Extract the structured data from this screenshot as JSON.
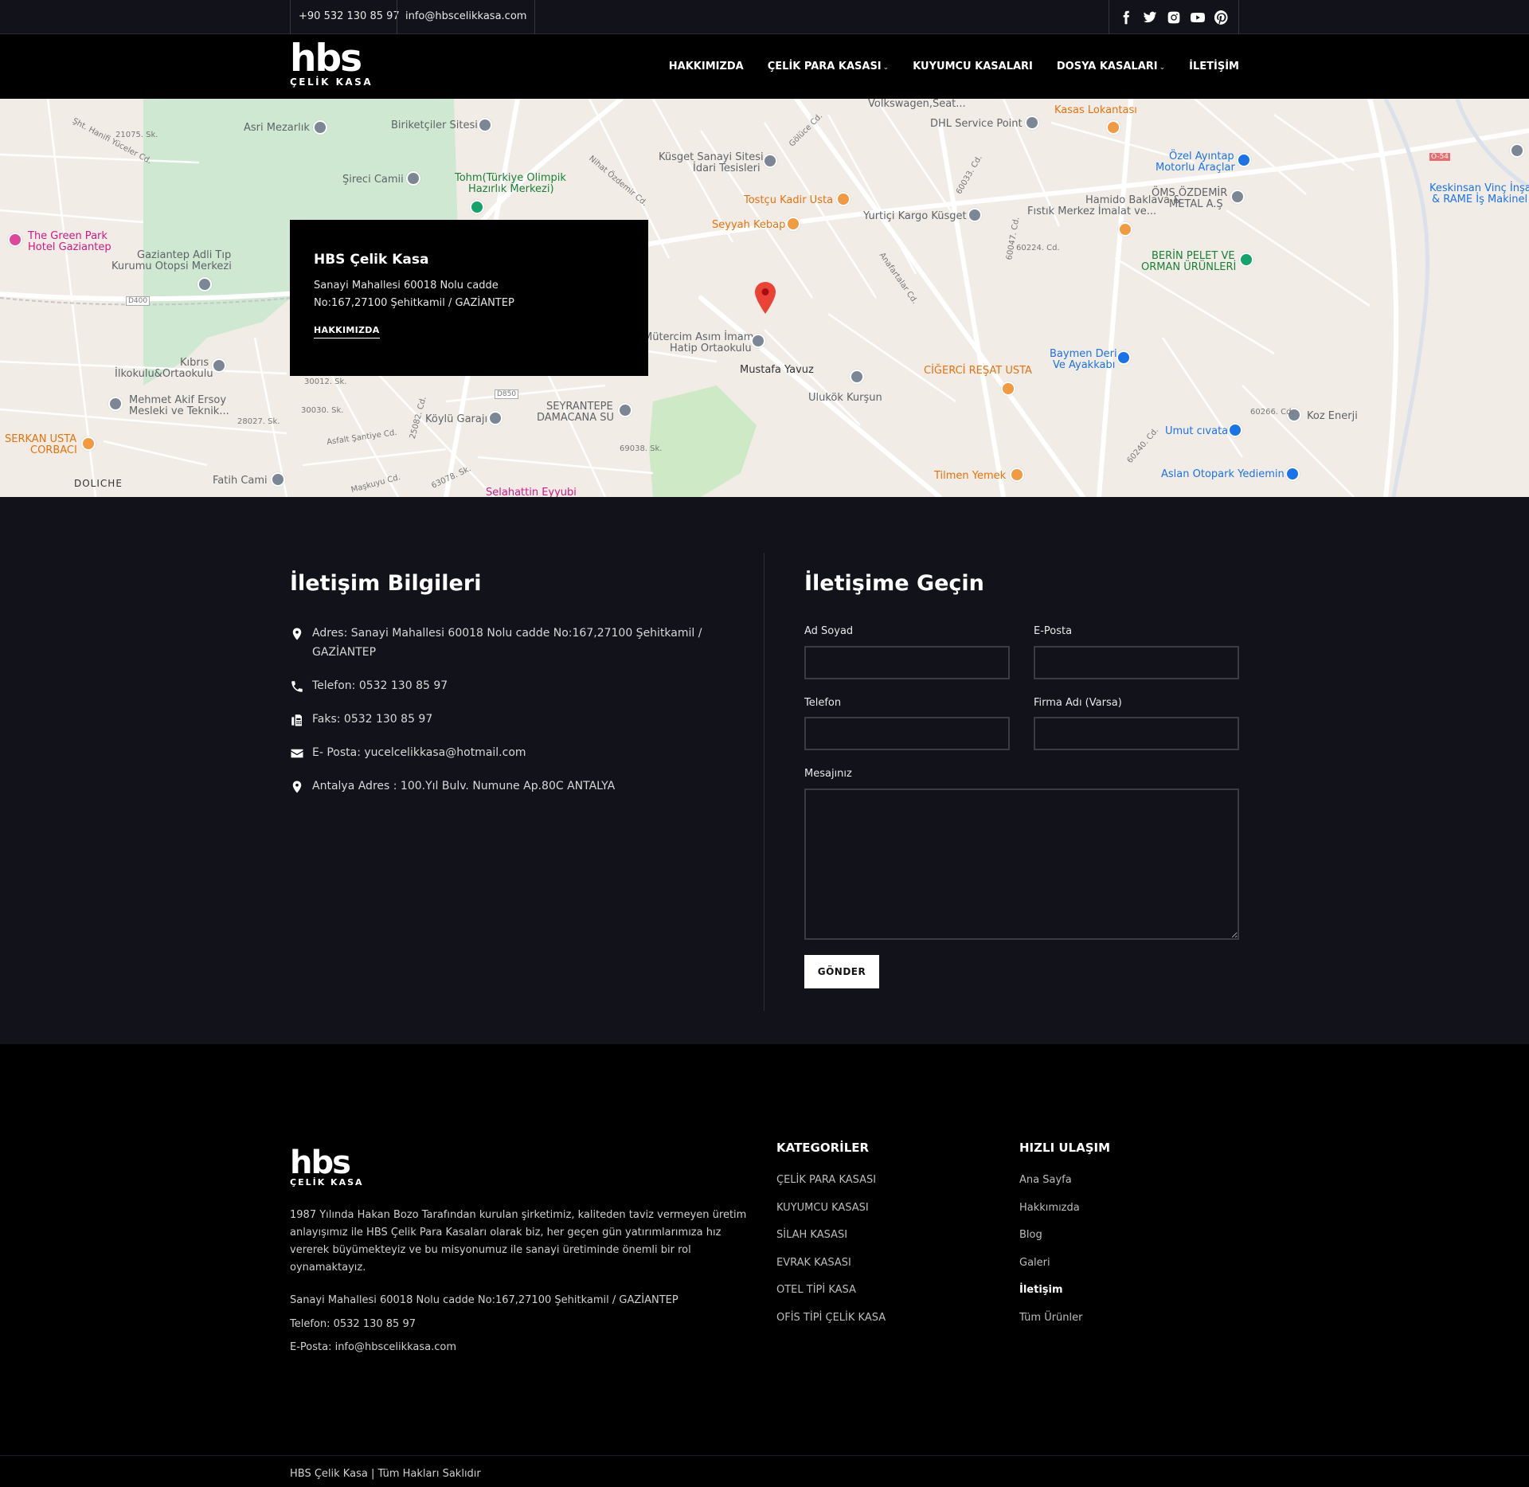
{
  "topbar": {
    "phone": "+90 532 130 85 97",
    "email": "info@hbscelikkasa.com",
    "social": [
      "facebook-icon",
      "twitter-icon",
      "instagram-icon",
      "youtube-icon",
      "pinterest-icon"
    ]
  },
  "header": {
    "logo_main": "hbs",
    "logo_sub": "ÇELİK KASA",
    "nav": [
      {
        "label": "HAKKIMIZDA",
        "dropdown": false
      },
      {
        "label": "ÇELİK PARA KASASI",
        "dropdown": true
      },
      {
        "label": "KUYUMCU KASALARI",
        "dropdown": false
      },
      {
        "label": "DOSYA KASALARI",
        "dropdown": true
      },
      {
        "label": "İLETİŞİM",
        "dropdown": false
      }
    ]
  },
  "map": {
    "card_title": "HBS Çelik Kasa",
    "card_address_1": "Sanayi Mahallesi 60018 Nolu cadde",
    "card_address_2": "No:167,27100 Şehitkamil / GAZİANTEP",
    "card_link": "HAKKIMIZDA",
    "places": {
      "asri": "Asri Mezarlık",
      "biriket": "Biriketçiler Sitesi",
      "sirec": "Şireci Camii",
      "tohm1": "Tohm(Türkiye Olimpik",
      "tohm2": "Hazırlık Merkezi)",
      "kusget1": "Küsget Sanayi Sitesi",
      "kusget2": "İdari Tesisleri",
      "tostcu": "Tostçu Kadir Usta",
      "seyyah": "Seyyah Kebap",
      "dhl": "DHL Service Point",
      "volks": "Volkswagen,Seat...",
      "kasas": "Kasas Lokantası",
      "ozel1": "Özel Ayıntap",
      "ozel2": "Motorlu Araçlar",
      "oms1": "ÖMS ÖZDEMİR",
      "oms2": "METAL A.Ş",
      "hamido1": "Hamido Baklava &",
      "hamido2": "Fıstık Merkez İmalat ve...",
      "yurtici": "Yurtiçi Kargo Küsget",
      "keskin1": "Keskinsan Vinç İnşa",
      "keskin2": "& RAME İş Makinel",
      "berin1": "BERİN PELET VE",
      "berin2": "ORMAN ÜRÜNLERİ",
      "green1": "The Green Park",
      "green2": "Hotel Gaziantep",
      "adli1": "Gaziantep Adli Tıp",
      "adli2": "Kurumu Otopsi Merkezi",
      "kibris1": "Kıbrıs",
      "kibris2": "İlkokulu&Ortaokulu",
      "mehmet1": "Mehmet Akif Ersoy",
      "mehmet2": "Mesleki ve Teknik...",
      "serkan1": "SERKAN USTA",
      "serkan2": "CORBACI",
      "doliche": "DOLICHE",
      "fatih": "Fatih Cami",
      "koylu": "Köylü Garajı",
      "seyrantepe1": "SEYRANTEPE",
      "seyrantepe2": "DAMACANA SU",
      "asim1": "Mütercim Asım İmam",
      "asim2": "Hatip Ortaokulu",
      "mustafa": "Mustafa Yavuz",
      "ulukok": "Ulukök Kurşun",
      "cigerci": "CİĞERCİ REŞAT USTA",
      "baymen1": "Baymen Deri",
      "baymen2": "Ve Ayakkabı",
      "koz": "Koz Enerji",
      "umut": "Umut cıvata",
      "tilmen": "Tilmen Yemek",
      "aslan": "Aslan Otopark Yediemin",
      "selahattin": "Selahattin Eyyubi"
    },
    "roads": {
      "r1": "Şht. Hanifi Yüceler Cd.",
      "r2": "21075. Sk.",
      "r3": "Nihat Özdemir Cd.",
      "r4": "Gölüce Cd.",
      "r5": "Anafartalar Cd.",
      "r6": "60033. Cd.",
      "r7": "60047. Cd.",
      "r8": "60224. Cd.",
      "r9": "25082. Cd.",
      "r10": "Maşkuyu Cd.",
      "r11": "63078. Sk.",
      "r12": "69038. Sk.",
      "r13": "30012. Sk.",
      "r14": "30030. Sk.",
      "r15": "28027. Sk.",
      "r16": "60266. Cd.",
      "r17": "60240. Cd.",
      "r18": "D400",
      "r19": "D850",
      "r20": "O-54",
      "r21": "Asfalt Şantiye Cd."
    }
  },
  "contact": {
    "info_title": "İletişim Bilgileri",
    "info": [
      {
        "icon": "map-marker-icon",
        "text": "Adres: Sanayi Mahallesi 60018 Nolu cadde No:167,27100 Şehitkamil / GAZİANTEP"
      },
      {
        "icon": "phone-icon",
        "text": "Telefon: 0532 130 85 97"
      },
      {
        "icon": "fax-icon",
        "text": "Faks: 0532 130 85 97"
      },
      {
        "icon": "envelope-icon",
        "text": "E- Posta: yucelcelikkasa@hotmail.com"
      },
      {
        "icon": "map-marker-icon",
        "text": "Antalya Adres : 100.Yıl Bulv. Numune Ap.80C ANTALYA"
      }
    ],
    "form_title": "İletişime Geçin",
    "labels": {
      "name": "Ad Soyad",
      "email": "E-Posta",
      "phone": "Telefon",
      "company": "Firma Adı (Varsa)",
      "message": "Mesajınız"
    },
    "values": {
      "name": "",
      "email": "",
      "phone": "",
      "company": "",
      "message": ""
    },
    "submit": "GÖNDER"
  },
  "footer": {
    "logo_main": "hbs",
    "logo_sub": "ÇELİK KASA",
    "about": "1987 Yılında Hakan Bozo Tarafından kurulan şirketimiz, kaliteden taviz vermeyen üretim anlayışımız ile HBS Çelik Para Kasaları olarak biz, her geçen gün yatırımlarımıza hız vererek büyümekteyiz ve bu misyonumuz ile sanayi üretiminde önemli bir rol oynamaktayız.",
    "address": "Sanayi Mahallesi 60018 Nolu cadde No:167,27100 Şehitkamil / GAZİANTEP",
    "phone": "Telefon: 0532 130 85 97",
    "email": "E-Posta: info@hbscelikkasa.com",
    "categories_title": "KATEGORİLER",
    "categories": [
      "ÇELİK PARA KASASI",
      "KUYUMCU KASASI",
      "SİLAH KASASI",
      "EVRAK KASASI",
      "OTEL TİPİ KASA",
      "OFİS TİPİ ÇELİK KASA"
    ],
    "quick_title": "HIZLI ULAŞIM",
    "quick": [
      "Ana Sayfa",
      "Hakkımızda",
      "Blog",
      "Galeri",
      "İletişim",
      "Tüm Ürünler"
    ],
    "quick_active": "İletişim",
    "copyright": "HBS Çelik Kasa | Tüm Hakları Saklıdır"
  }
}
